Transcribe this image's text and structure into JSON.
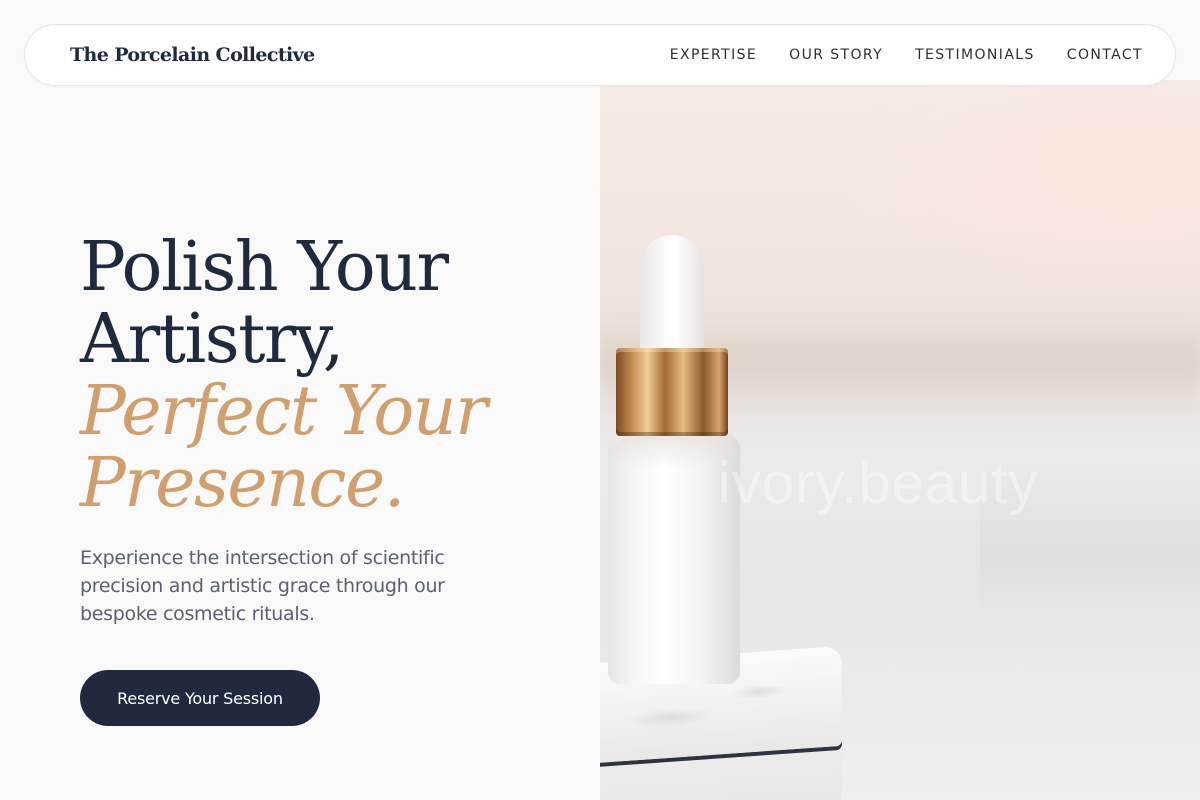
{
  "header": {
    "brand": "The Porcelain Collective",
    "nav": [
      {
        "label": "EXPERTISE"
      },
      {
        "label": "OUR STORY"
      },
      {
        "label": "TESTIMONIALS"
      },
      {
        "label": "CONTACT"
      }
    ]
  },
  "hero": {
    "title_line1": "Polish Your",
    "title_line2": "Artistry,",
    "accent_line1": "Perfect Your",
    "accent_line2": "Presence.",
    "description": "Experience the intersection of scientific precision and artistic grace through our bespoke cosmetic rituals.",
    "cta_label": "Reserve Your Session"
  },
  "image": {
    "watermark": "ivory.beauty"
  },
  "colors": {
    "navy": "#1f2a3f",
    "accent_gold": "#cf9f70",
    "body_text": "#5a6170",
    "background": "#f9f9f9"
  }
}
